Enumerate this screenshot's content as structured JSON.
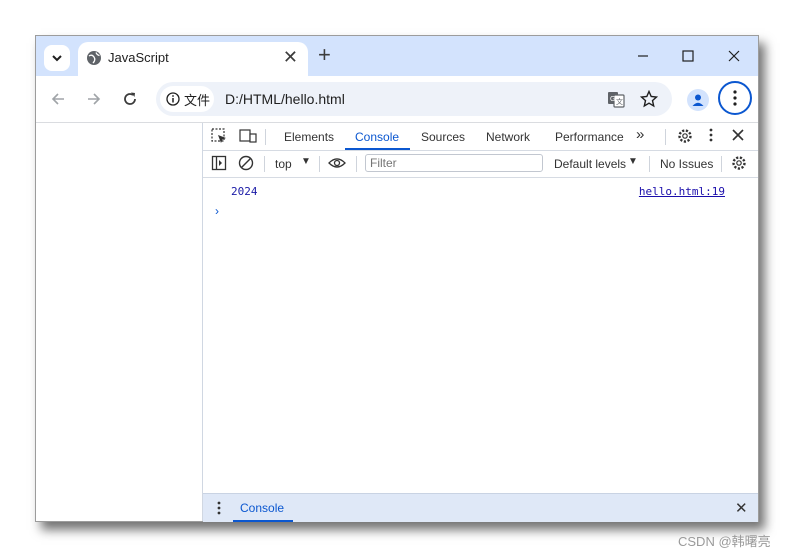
{
  "tab": {
    "title": "JavaScript",
    "close": "✕"
  },
  "new_tab": "+",
  "omnibox": {
    "security_chip": "文件",
    "url": "D:/HTML/hello.html"
  },
  "devtools": {
    "tabs": [
      "Elements",
      "Console",
      "Sources",
      "Network",
      "Performance"
    ],
    "more_tabs": "»",
    "context": "top",
    "filter_placeholder": "Filter",
    "levels": "Default levels",
    "issues": "No Issues",
    "console": {
      "value": "2024",
      "source": "hello.html:19",
      "prompt": "›"
    },
    "drawer_tab": "Console",
    "drawer_close": "✕"
  },
  "watermark": "CSDN @韩曙亮",
  "colors": {
    "accent": "#0b57d0",
    "titlebar": "#d3e3fd",
    "drawer": "#dfe8f7"
  }
}
